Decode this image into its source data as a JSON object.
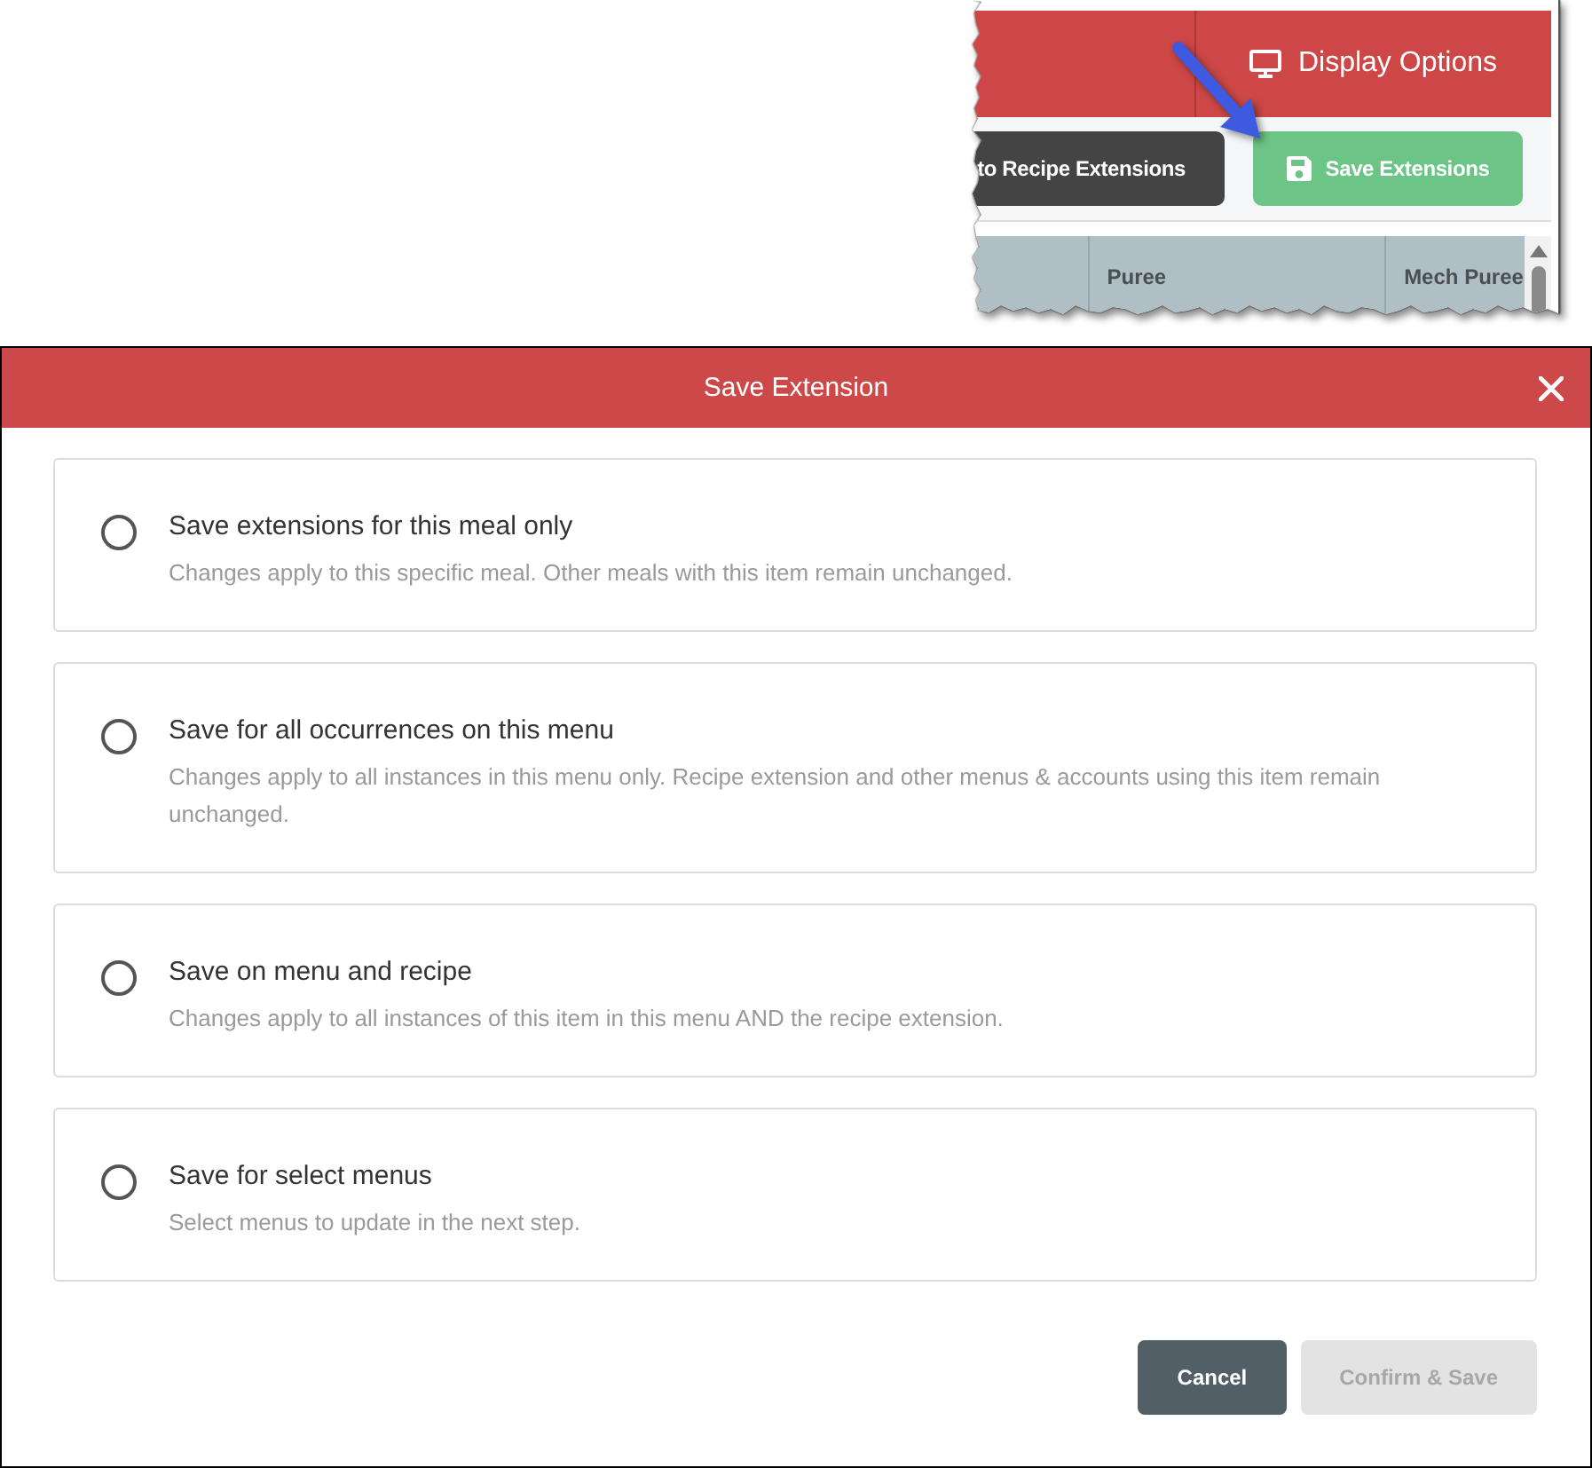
{
  "inset": {
    "header": {
      "button": "Display Options"
    },
    "toolbar": {
      "buttons": [
        {
          "kind": "dark",
          "label": "to Recipe Extensions"
        },
        {
          "kind": "save",
          "label": "Save Extensions"
        }
      ]
    },
    "table": {
      "columns": [
        "Puree",
        "Mech Puree"
      ]
    }
  },
  "dialog": {
    "title": "Save Extension",
    "options": [
      {
        "title": "Save extensions for this meal only",
        "description": "Changes apply to this specific meal. Other meals with this item remain unchanged.",
        "selected": false
      },
      {
        "title": "Save for all occurrences on this menu",
        "description": "Changes apply to all instances in this menu only. Recipe extension and other menus & accounts using this item remain unchanged.",
        "selected": false
      },
      {
        "title": "Save on menu and recipe",
        "description": "Changes apply to all instances of this item in this menu AND the recipe extension.",
        "selected": false
      },
      {
        "title": "Save for select menus",
        "description": "Select menus to update in the next step.",
        "selected": false
      }
    ],
    "buttons": [
      {
        "kind": "cancel",
        "label": "Cancel",
        "disabled": false
      },
      {
        "kind": "confirm",
        "label": "Confirm & Save",
        "disabled": true
      }
    ]
  }
}
